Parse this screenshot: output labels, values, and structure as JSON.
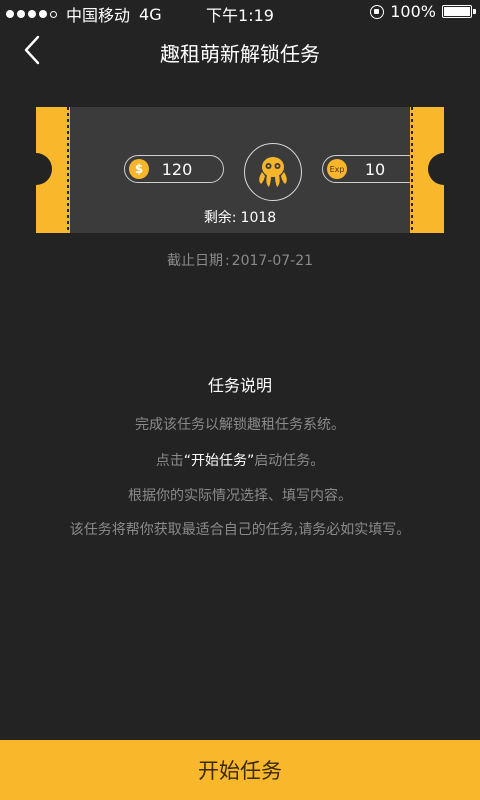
{
  "status_bar": {
    "carrier": "中国移动",
    "network": "4G",
    "time": "下午1:19",
    "battery": "100%",
    "battery_level": 1.0,
    "signal_dots_filled": 4,
    "signal_dots_total": 5
  },
  "nav": {
    "back_icon": "chevron-left-icon",
    "title": "趣租萌新解锁任务"
  },
  "ticket": {
    "coin_icon": "coin-icon",
    "coin_symbol": "$",
    "coin_value": "120",
    "mascot_icon": "octopus-mascot-icon",
    "exp_icon": "exp-icon",
    "exp_symbol": "Exp",
    "exp_value": "10",
    "remaining_label": "剩余:",
    "remaining_value": "1018"
  },
  "deadline": {
    "label": "截止日期",
    "separator": ":",
    "date": "2017-07-21"
  },
  "description": {
    "title": "任务说明",
    "line1": "完成该任务以解锁趣租任务系统。",
    "line2_prefix": "点击",
    "line2_highlight": "“开始任务”",
    "line2_suffix": "启动任务。",
    "line3": "根据你的实际情况选择、填写内容。",
    "line4": "该任务将帮你获取最适合自己的任务,请务必如实填写。"
  },
  "actions": {
    "start_label": "开始任务"
  },
  "colors": {
    "background": "#232323",
    "ticket_body": "#3b3b3b",
    "accent": "#f9b72c",
    "muted_text": "#8a8a8a"
  }
}
